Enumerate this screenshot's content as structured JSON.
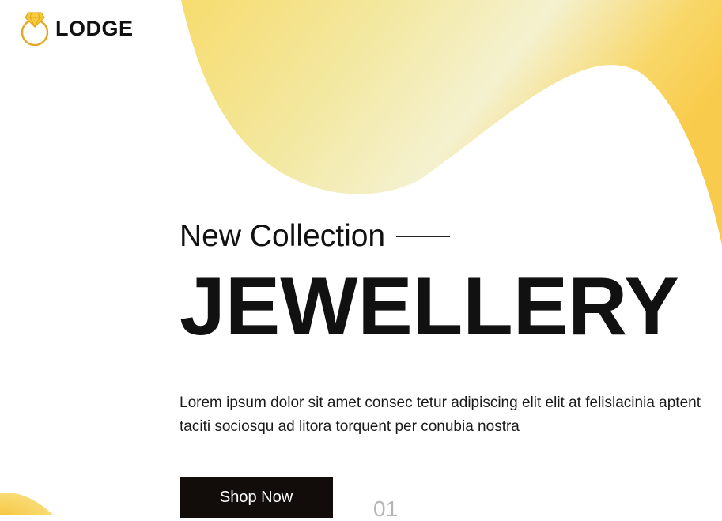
{
  "brand": {
    "name": "LODGE",
    "icon": "diamond-ring-icon",
    "color": "#e6a51e"
  },
  "hero": {
    "eyebrow": "New Collection",
    "headline": "JEWELLERY",
    "description_line1": "Lorem ipsum dolor sit amet consec tetur adipiscing elit elit at felislacinia aptent",
    "description_line2": "taciti sociosqu ad litora torquent per conubia nostra",
    "cta_label": "Shop Now",
    "slide_number": "01"
  },
  "colors": {
    "accent_yellow": "#f6d86a",
    "button_dark": "#120c0a",
    "text_dark": "#111111"
  }
}
